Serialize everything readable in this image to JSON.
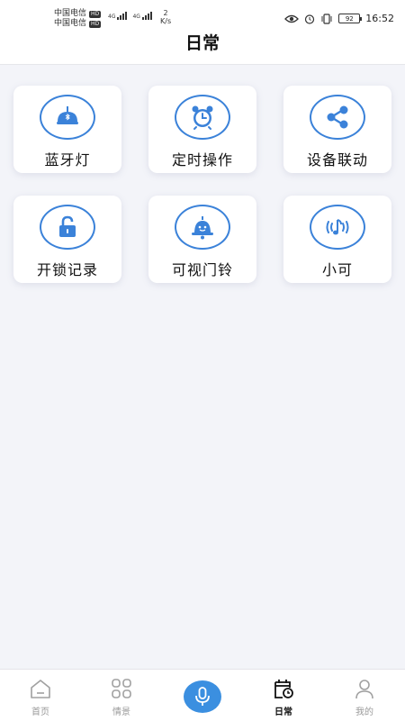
{
  "status_bar": {
    "carrier1": "中国电信",
    "carrier2": "中国电信",
    "hd": "HD",
    "net1": "4G",
    "net2": "4G",
    "speed_value": "2",
    "speed_unit": "K/s",
    "battery": "92",
    "time": "16:52"
  },
  "header": {
    "title": "日常"
  },
  "cards": [
    {
      "label": "蓝牙灯",
      "icon": "bluetooth-lamp-icon"
    },
    {
      "label": "定时操作",
      "icon": "alarm-clock-icon"
    },
    {
      "label": "设备联动",
      "icon": "share-icon"
    },
    {
      "label": "开锁记录",
      "icon": "unlock-icon"
    },
    {
      "label": "可视门铃",
      "icon": "doorbell-icon"
    },
    {
      "label": "小可",
      "icon": "music-note-icon"
    }
  ],
  "nav": {
    "home": "首页",
    "scene": "情景",
    "daily": "日常",
    "mine": "我的",
    "active": "日常"
  },
  "colors": {
    "accent": "#3b82d9",
    "background": "#f3f4f9",
    "card": "#ffffff"
  }
}
